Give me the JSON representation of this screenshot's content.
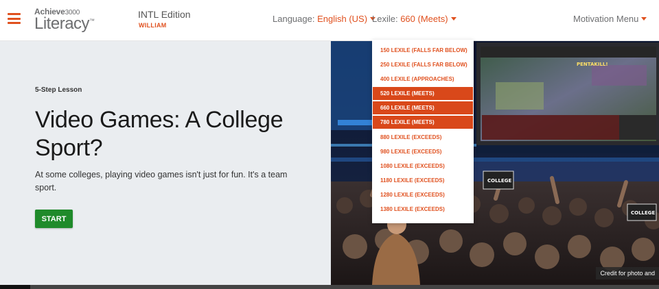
{
  "header": {
    "logo_top": "Achieve",
    "logo_top_num": "3000",
    "logo_bottom": "Literacy",
    "edition": "INTL Edition",
    "user_name": "WILLIAM",
    "language_label": "Language:",
    "language_value": "English (US)",
    "lexile_label": "Lexile:",
    "lexile_value": "660 (Meets)",
    "motivation_menu": "Motivation Menu"
  },
  "lesson": {
    "label": "5-Step Lesson",
    "title": "Video Games: A College Sport?",
    "description": "At some colleges, playing video games isn't just for fun. It's a team sport.",
    "start_label": "START"
  },
  "photo": {
    "credit_label": "Credit for photo and",
    "screen_text": "PENTAKILL!",
    "sign_text_1": "COLLEGE",
    "sign_text_2": "COLLEGE"
  },
  "lexile_dropdown": {
    "items": [
      {
        "label": "150 LEXILE (FALLS FAR BELOW)",
        "meets": false
      },
      {
        "label": "250 LEXILE (FALLS FAR BELOW)",
        "meets": false
      },
      {
        "label": "400 LEXILE (APPROACHES)",
        "meets": false
      },
      {
        "label": "520 LEXILE (MEETS)",
        "meets": true
      },
      {
        "label": "660 LEXILE (MEETS)",
        "meets": true
      },
      {
        "label": "780 LEXILE (MEETS)",
        "meets": true
      },
      {
        "label": "880 LEXILE (EXCEEDS)",
        "meets": false
      },
      {
        "label": "980 LEXILE (EXCEEDS)",
        "meets": false
      },
      {
        "label": "1080 LEXILE (EXCEEDS)",
        "meets": false
      },
      {
        "label": "1180 LEXILE (EXCEEDS)",
        "meets": false
      },
      {
        "label": "1280 LEXILE (EXCEEDS)",
        "meets": false
      },
      {
        "label": "1380 LEXILE (EXCEEDS)",
        "meets": false
      }
    ]
  },
  "colors": {
    "accent": "#e0501e",
    "start_button": "#1f8a2a",
    "meets_highlight": "#d9481a",
    "panel_bg": "#eaedf0"
  },
  "icons": {
    "menu": "hamburger-menu-icon",
    "caret": "caret-down-icon"
  }
}
